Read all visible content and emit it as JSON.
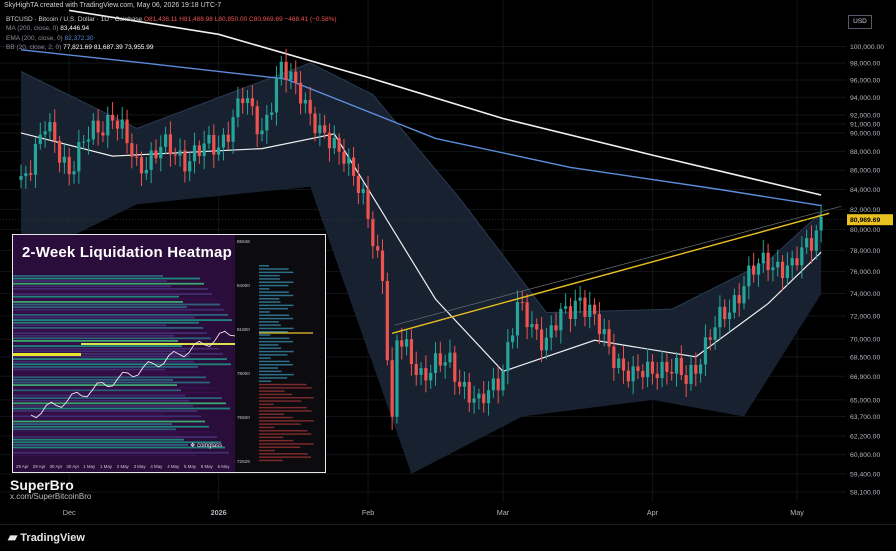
{
  "header": {
    "published_by": "SkyHighTA created with TradingView.com, May 06, 2026 19:18 UTC-7",
    "symbol_line": "BTCUSD · Bitcoin / U.S. Dollar · 1D · Coinbase",
    "ohlc": "O81,438.11 H81,488.98 L80,850.00 C80,969.69 −468.41 (−0.58%)"
  },
  "indicators": [
    {
      "label": "MA (200, close, 0)",
      "value": "83,446.94",
      "color": "#ffffff"
    },
    {
      "label": "EMA (200, close, 0)",
      "value": "82,372.30",
      "color": "#5b8ddb"
    },
    {
      "label": "BB (20, close, 2, 0)",
      "value": "77,821.69  81,687.39  73,955.99",
      "color": "#ffffff"
    }
  ],
  "price_axis": {
    "currency": "USD",
    "current_price": "80,969.69",
    "current_color": "#e8c020",
    "labels": [
      "100,000.00",
      "98,000.00",
      "96,000.00",
      "94,000.00",
      "92,000.00",
      "91,000.00",
      "90,000.00",
      "88,000.00",
      "86,000.00",
      "84,000.00",
      "82,000.00",
      "80,000.00",
      "78,000.00",
      "76,000.00",
      "74,000.00",
      "72,000.00",
      "70,000.00",
      "68,500.00",
      "66,900.00",
      "65,000.00",
      "63,700.00",
      "62,200.00",
      "60,800.00",
      "59,400.00",
      "58,100.00"
    ]
  },
  "time_axis": {
    "labels": [
      "Dec",
      "2026",
      "Feb",
      "Mar",
      "Apr",
      "May"
    ]
  },
  "inset": {
    "title": "2-Week Liquidation Heatmap",
    "brand": "coinglass",
    "x_labels": [
      "29 Apr",
      "29 Apr",
      "30 Apr",
      "30 Apr",
      "1 May",
      "1 May",
      "2 May",
      "3 May",
      "4 May",
      "4 May",
      "5 May",
      "5 May",
      "6 May"
    ],
    "y_labels": [
      "85648",
      "84000",
      "81800",
      "78000",
      "75500",
      "72629"
    ]
  },
  "watermark": {
    "name": "SuperBro",
    "handle": "x.com/SuperBitcoinBro"
  },
  "footer": {
    "brand": "TradingView"
  },
  "chart_data": {
    "type": "candlestick",
    "y_scale": "log",
    "ylim": [
      58000,
      100000
    ],
    "x_ticks": [
      "Dec",
      "2026",
      "Feb",
      "Mar",
      "Apr",
      "May"
    ],
    "close_series": [
      {
        "date": "Nov 21",
        "close": 85000
      },
      {
        "date": "Nov 26",
        "close": 90500
      },
      {
        "date": "Dec 1",
        "close": 86300
      },
      {
        "date": "Dec 5",
        "close": 89400
      },
      {
        "date": "Dec 10",
        "close": 92200
      },
      {
        "date": "Dec 15",
        "close": 86400
      },
      {
        "date": "Dec 20",
        "close": 88300
      },
      {
        "date": "Dec 25",
        "close": 87400
      },
      {
        "date": "Jan 1",
        "close": 88700
      },
      {
        "date": "Jan 6",
        "close": 93700
      },
      {
        "date": "Jan 10",
        "close": 90500
      },
      {
        "date": "Jan 14",
        "close": 96900
      },
      {
        "date": "Jan 18",
        "close": 95100
      },
      {
        "date": "Jan 22",
        "close": 89400
      },
      {
        "date": "Jan 27",
        "close": 88300
      },
      {
        "date": "Jan 31",
        "close": 82500
      },
      {
        "date": "Feb 4",
        "close": 76000
      },
      {
        "date": "Feb 6",
        "close": 62900
      },
      {
        "date": "Feb 7",
        "close": 69800
      },
      {
        "date": "Feb 12",
        "close": 67300
      },
      {
        "date": "Feb 18",
        "close": 68000
      },
      {
        "date": "Feb 24",
        "close": 64300
      },
      {
        "date": "Mar 1",
        "close": 67700
      },
      {
        "date": "Mar 4",
        "close": 72500
      },
      {
        "date": "Mar 10",
        "close": 70000
      },
      {
        "date": "Mar 17",
        "close": 73900
      },
      {
        "date": "Mar 22",
        "close": 69900
      },
      {
        "date": "Mar 28",
        "close": 66600
      },
      {
        "date": "Apr 2",
        "close": 67900
      },
      {
        "date": "Apr 8",
        "close": 66700
      },
      {
        "date": "Apr 14",
        "close": 70800
      },
      {
        "date": "Apr 20",
        "close": 75000
      },
      {
        "date": "Apr 25",
        "close": 77200
      },
      {
        "date": "Apr 30",
        "close": 76000
      },
      {
        "date": "May 3",
        "close": 78700
      },
      {
        "date": "May 6",
        "close": 80970
      }
    ],
    "ma200": [
      {
        "date": "Dec 1",
        "value": 104500
      },
      {
        "date": "Jan 1",
        "value": 101500
      },
      {
        "date": "Feb 1",
        "value": 96300
      },
      {
        "date": "Mar 1",
        "value": 91600
      },
      {
        "date": "Apr 1",
        "value": 87600
      },
      {
        "date": "May 6",
        "value": 83447
      }
    ],
    "ema200": [
      {
        "date": "Nov 21",
        "value": 99600
      },
      {
        "date": "Dec 15",
        "value": 98100
      },
      {
        "date": "Jan 15",
        "value": 96100
      },
      {
        "date": "Feb 15",
        "value": 89400
      },
      {
        "date": "Mar 15",
        "value": 86300
      },
      {
        "date": "Apr 15",
        "value": 84000
      },
      {
        "date": "May 6",
        "value": 82372
      }
    ],
    "bb_basis": [
      {
        "date": "Nov 21",
        "value": 90000
      },
      {
        "date": "Dec 10",
        "value": 87500
      },
      {
        "date": "Jan 10",
        "value": 88300
      },
      {
        "date": "Jan 25",
        "value": 89900
      },
      {
        "date": "Feb 15",
        "value": 73500
      },
      {
        "date": "Mar 1",
        "value": 67300
      },
      {
        "date": "Mar 20",
        "value": 69900
      },
      {
        "date": "Apr 10",
        "value": 68500
      },
      {
        "date": "Apr 25",
        "value": 73100
      },
      {
        "date": "May 6",
        "value": 77822
      }
    ],
    "bb_upper": [
      {
        "date": "Nov 21",
        "value": 97000
      },
      {
        "date": "Dec 15",
        "value": 90500
      },
      {
        "date": "Jan 20",
        "value": 98000
      },
      {
        "date": "Feb 2",
        "value": 94300
      },
      {
        "date": "Feb 20",
        "value": 83100
      },
      {
        "date": "Mar 10",
        "value": 72300
      },
      {
        "date": "Apr 5",
        "value": 72600
      },
      {
        "date": "Apr 25",
        "value": 77000
      },
      {
        "date": "May 6",
        "value": 81687
      }
    ],
    "bb_lower": [
      {
        "date": "Nov 21",
        "value": 77000
      },
      {
        "date": "Dec 15",
        "value": 82500
      },
      {
        "date": "Jan 20",
        "value": 84300
      },
      {
        "date": "Feb 10",
        "value": 59400
      },
      {
        "date": "Mar 5",
        "value": 63700
      },
      {
        "date": "Apr 1",
        "value": 65000
      },
      {
        "date": "Apr 20",
        "value": 63700
      },
      {
        "date": "May 6",
        "value": 73956
      }
    ],
    "support_line": {
      "from": {
        "date": "Feb 6",
        "value": 70500
      },
      "to": {
        "date": "May 6",
        "value": 81500
      },
      "color": "#e8c020"
    }
  }
}
